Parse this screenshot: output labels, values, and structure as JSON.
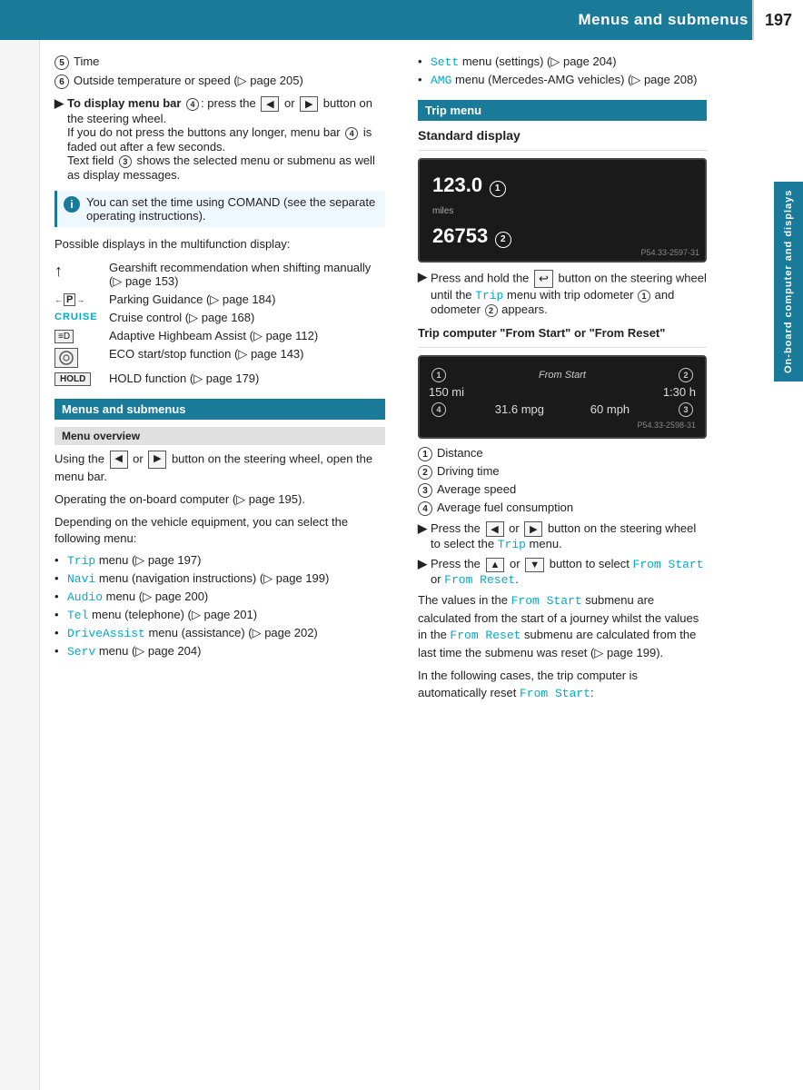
{
  "header": {
    "title": "Menus and submenus",
    "page_number": "197"
  },
  "side_tab": {
    "label": "On-board computer and displays"
  },
  "left_col": {
    "numbered_items": [
      {
        "num": "5",
        "text": "Time"
      },
      {
        "num": "6",
        "text": "Outside temperature or speed (▷ page 205)"
      }
    ],
    "display_menu_bar": {
      "arrow": "▶",
      "label": "To display menu bar",
      "circle": "4",
      "text": ": press the",
      "btn_left": "◀",
      "or": "or",
      "btn_right": "▶",
      "rest": "button on the steering wheel. If you do not press the buttons any longer, menu bar",
      "circle2": "4",
      "rest2": "is faded out after a few seconds.",
      "text3": "Text field",
      "circle3": "3",
      "text4": "shows the selected menu or submenu as well as display messages."
    },
    "info_box": {
      "text": "You can set the time using COMAND (see the separate operating instructions)."
    },
    "possible_displays": "Possible displays in the multifunction display:",
    "feature_rows": [
      {
        "icon_type": "gear_arrow",
        "icon_text": "↑",
        "text": "Gearshift recommendation when shifting manually (▷ page 153)"
      },
      {
        "icon_type": "parking",
        "icon_text": "←P→",
        "text": "Parking Guidance (▷ page 184)"
      },
      {
        "icon_type": "cruise",
        "icon_text": "CRUISE",
        "text": "Cruise control (▷ page 168)"
      },
      {
        "icon_type": "highbeam",
        "icon_text": "≡D",
        "text": "Adaptive Highbeam Assist (▷ page 112)"
      },
      {
        "icon_type": "eco",
        "icon_text": "◎",
        "text": "ECO start/stop function (▷ page 143)"
      },
      {
        "icon_type": "hold",
        "icon_text": "HOLD",
        "text": "HOLD function (▷ page 179)"
      }
    ],
    "menus_submenus_header": "Menus and submenus",
    "menu_overview_header": "Menu overview",
    "menu_overview_text1": "Using the",
    "btn_left2": "◀",
    "or2": "or",
    "btn_right2": "▶",
    "menu_overview_text2": "button on the steering wheel, open the menu bar.",
    "operating_text": "Operating the on-board computer (▷ page 195).",
    "depending_text": "Depending on the vehicle equipment, you can select the following menu:",
    "menu_items": [
      {
        "name": "Trip",
        "text": " menu (▷ page 197)"
      },
      {
        "name": "Navi",
        "text": " menu (navigation instructions) (▷ page 199)"
      },
      {
        "name": "Audio",
        "text": " menu (▷ page 200)"
      },
      {
        "name": "Tel",
        "text": " menu (telephone) (▷ page 201)"
      },
      {
        "name": "DriveAssist",
        "text": " menu (assistance) (▷ page 202)"
      },
      {
        "name": "Serv",
        "text": " menu (▷ page 204)"
      }
    ]
  },
  "right_col": {
    "menu_items_continued": [
      {
        "name": "Sett",
        "text": " menu (settings) (▷ page 204)"
      },
      {
        "name": "AMG",
        "text": " menu (Mercedes-AMG vehicles) (▷ page 208)"
      }
    ],
    "trip_menu_header": "Trip menu",
    "standard_display_title": "Standard display",
    "screen1": {
      "value1": "123.0",
      "label1": "miles",
      "value2": "26753",
      "callout1": "1",
      "callout2": "2",
      "caption": "P54.33-2597-31"
    },
    "press_hold_text": "Press and hold the",
    "btn_symbol": "↩",
    "press_hold_text2": "button on the steering wheel until the",
    "menu_name": "Trip",
    "press_hold_text3": "menu with trip odometer",
    "callout_1": "1",
    "press_hold_text4": "and odometer",
    "callout_2": "2",
    "press_hold_text5": "appears.",
    "trip_computer_title": "Trip computer \"From Start\" or \"From Reset\"",
    "screen2": {
      "label_top": "From Start",
      "callout1": "1",
      "callout2": "2",
      "value1": "150 mi",
      "value2": "1:30 h",
      "callout4": "4",
      "value3": "31.6 mpg",
      "value4": "60 mph",
      "callout3": "3",
      "caption": "P54.33-2598-31"
    },
    "numbered_items": [
      {
        "num": "1",
        "text": "Distance"
      },
      {
        "num": "2",
        "text": "Driving time"
      },
      {
        "num": "3",
        "text": "Average speed"
      },
      {
        "num": "4",
        "text": "Average fuel consumption"
      }
    ],
    "press_steer1": "Press the",
    "btn_left3": "◀",
    "or3": "or",
    "btn_right3": "▶",
    "press_steer2": "button on the steering wheel to select the",
    "trip_name": "Trip",
    "press_steer3": "menu.",
    "press_btn1": "Press the",
    "btn_up": "▲",
    "or4": "or",
    "btn_down": "▼",
    "press_btn2": "button to select",
    "from_start": "From Start",
    "or5": "or",
    "from_reset": "From Reset",
    "period": ".",
    "values_text1": "The values in the",
    "from_start2": "From Start",
    "values_text2": "submenu are calculated from the start of a journey whilst the values in the",
    "from_reset2": "From Reset",
    "values_text3": "submenu are calculated from the last time the submenu was reset (▷ page 199).",
    "auto_reset_text1": "In the following cases, the trip computer is automatically reset",
    "from_start3": "From Start",
    "auto_reset_text2": ":"
  }
}
